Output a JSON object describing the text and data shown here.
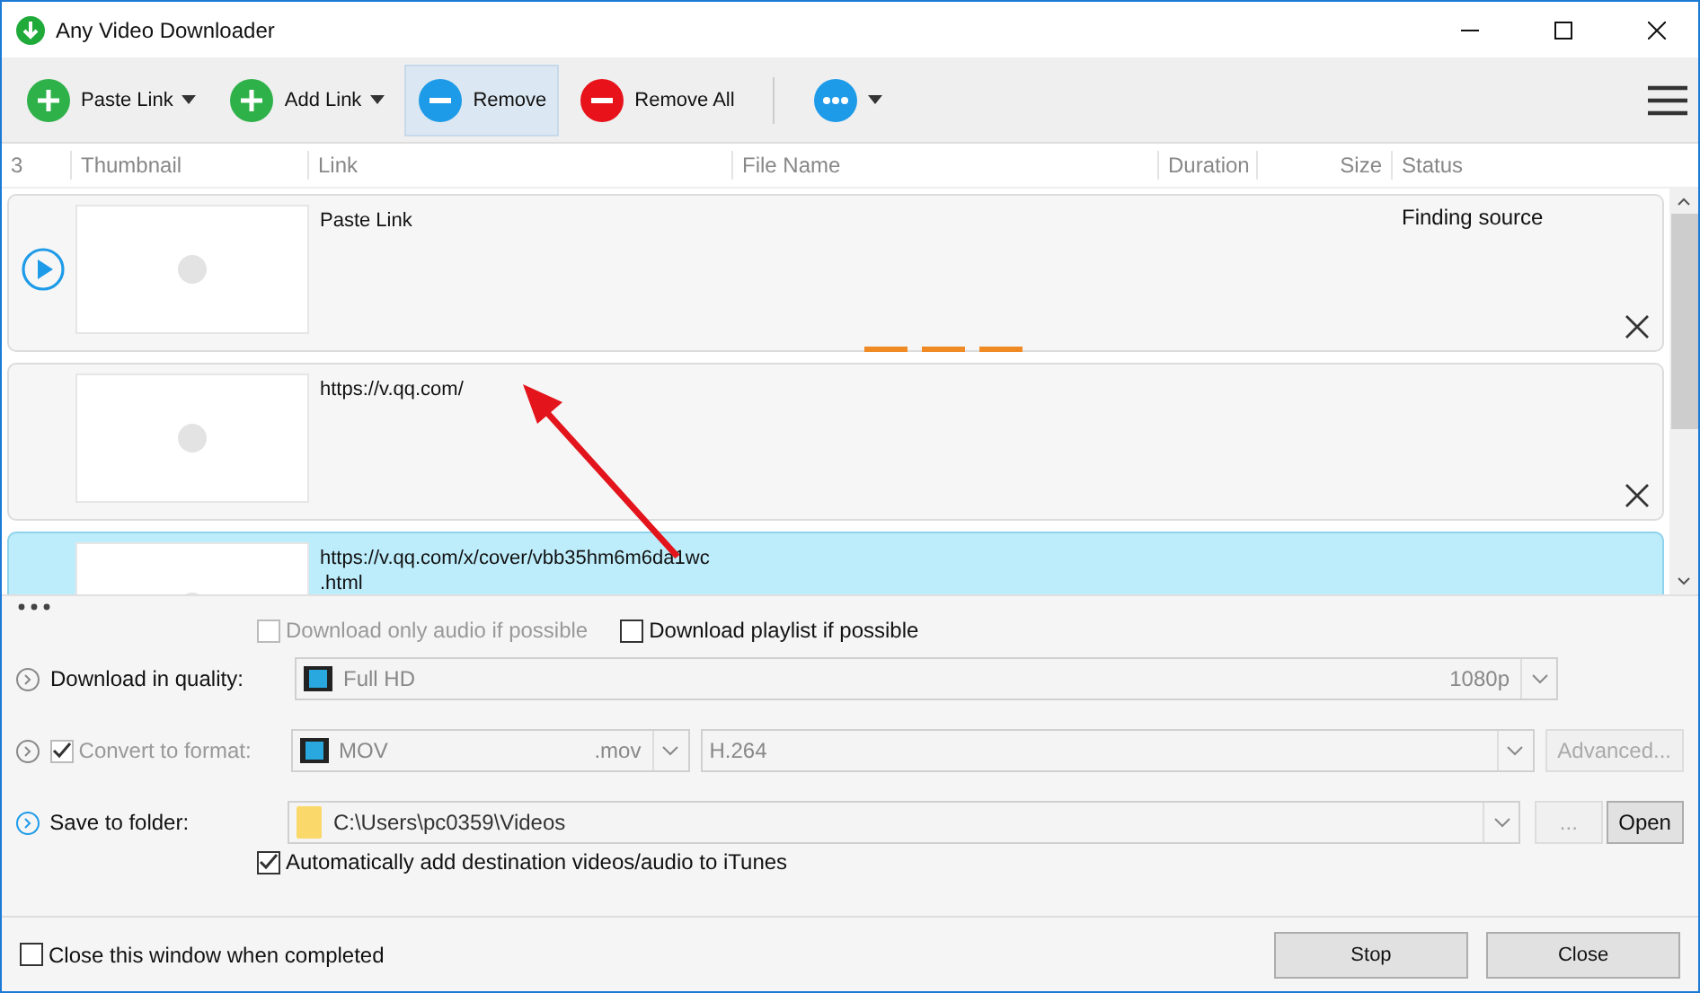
{
  "window": {
    "title": "Any Video Downloader"
  },
  "toolbar": {
    "buttons": [
      {
        "kind": "add",
        "label": "Paste Link",
        "dropdown": true,
        "selected": false
      },
      {
        "kind": "add",
        "label": "Add Link",
        "dropdown": true,
        "selected": false
      },
      {
        "kind": "remove",
        "label": "Remove",
        "dropdown": false,
        "selected": true
      },
      {
        "kind": "remove_all",
        "label": "Remove All",
        "dropdown": false,
        "selected": false
      },
      {
        "kind": "more",
        "dropdown": true,
        "selected": false
      }
    ]
  },
  "table": {
    "columns": [
      "3",
      "Thumbnail",
      "Link",
      "File Name",
      "Duration",
      "Size",
      "Status"
    ],
    "rows": [
      {
        "link": "Paste Link",
        "status": "Finding source",
        "playing": true,
        "busy": true,
        "selected": false
      },
      {
        "link": "https://v.qq.com/",
        "playing": false,
        "busy": false,
        "selected": false
      },
      {
        "link": "https://v.qq.com/x/cover/vbb35hm6m6da1wc .html",
        "playing": false,
        "busy": false,
        "selected": true
      }
    ]
  },
  "options": {
    "audio_only": {
      "label": "Download only audio if possible",
      "checked": false,
      "disabled": true
    },
    "playlist": {
      "label": "Download playlist if possible",
      "checked": false,
      "disabled": false
    },
    "quality": {
      "label": "Download in quality:",
      "value": "Full HD",
      "detail": "1080p"
    },
    "convert": {
      "label": "Convert to format:",
      "checked": true,
      "disabled": true,
      "format": "MOV",
      "extension": ".mov",
      "codec": "H.264",
      "advanced": "Advanced..."
    },
    "folder": {
      "label": "Save to folder:",
      "path": "C:\\Users\\pc0359\\Videos",
      "browse": "...",
      "open": "Open"
    },
    "itunes": {
      "label": "Automatically add destination videos/audio to iTunes",
      "checked": true
    }
  },
  "footer": {
    "close_when_done": {
      "label": "Close this window when completed",
      "checked": false
    },
    "buttons": [
      "Stop",
      "Close"
    ]
  }
}
